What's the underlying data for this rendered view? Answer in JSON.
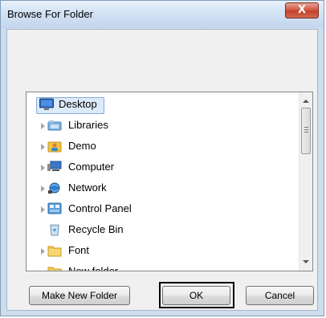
{
  "window": {
    "title": "Browse For Folder",
    "close_glyph": "X"
  },
  "tree": {
    "items": [
      {
        "label": "Desktop",
        "icon": "desktop-icon",
        "expander": false,
        "selected": true,
        "indent": 0
      },
      {
        "label": "Libraries",
        "icon": "libraries-icon",
        "expander": true,
        "selected": false,
        "indent": 1
      },
      {
        "label": "Demo",
        "icon": "user-folder-icon",
        "expander": true,
        "selected": false,
        "indent": 1
      },
      {
        "label": "Computer",
        "icon": "computer-icon",
        "expander": true,
        "selected": false,
        "indent": 1
      },
      {
        "label": "Network",
        "icon": "network-icon",
        "expander": true,
        "selected": false,
        "indent": 1
      },
      {
        "label": "Control Panel",
        "icon": "control-panel-icon",
        "expander": true,
        "selected": false,
        "indent": 1
      },
      {
        "label": "Recycle Bin",
        "icon": "recycle-bin-icon",
        "expander": false,
        "selected": false,
        "indent": 1
      },
      {
        "label": "Font",
        "icon": "folder-icon",
        "expander": true,
        "selected": false,
        "indent": 1
      },
      {
        "label": "New folder",
        "icon": "folder-icon",
        "expander": false,
        "selected": false,
        "indent": 1
      }
    ]
  },
  "buttons": {
    "make_new_folder": "Make New Folder",
    "ok": "OK",
    "cancel": "Cancel"
  }
}
